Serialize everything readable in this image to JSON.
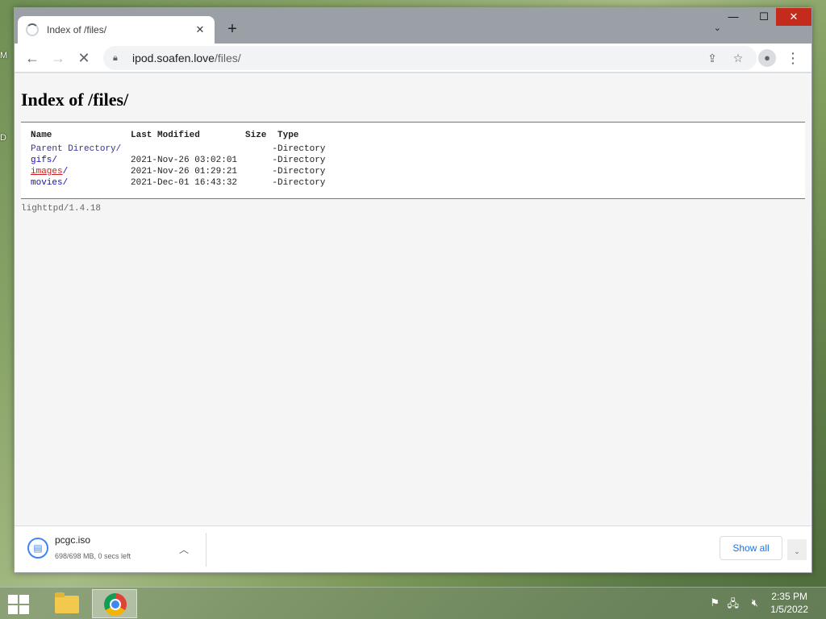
{
  "browser": {
    "tab_title": "Index of /files/",
    "new_tab_icon": "plus-icon",
    "url_host": "ipod.soafen.love",
    "url_path": "/files/"
  },
  "page": {
    "heading": "Index of /files/",
    "columns": [
      "Name",
      "Last Modified",
      "Size",
      "Type"
    ],
    "rows": [
      {
        "name": "Parent Directory/",
        "modified": "",
        "size": "-",
        "type": "Directory"
      },
      {
        "name": "gifs/",
        "modified": "2021-Nov-26 03:02:01",
        "size": "-",
        "type": "Directory"
      },
      {
        "name": "images",
        "suffix": "/",
        "modified": "2021-Nov-26 01:29:21",
        "size": "-",
        "type": "Directory"
      },
      {
        "name": "movies/",
        "modified": "2021-Dec-01 16:43:32",
        "size": "-",
        "type": "Directory"
      }
    ],
    "server_signature": "lighttpd/1.4.18"
  },
  "download": {
    "filename": "pcgc.iso",
    "status": "698/698 MB, 0 secs left",
    "show_all_label": "Show all"
  },
  "taskbar": {
    "time": "2:35 PM",
    "date": "1/5/2022"
  },
  "desktop": {
    "icon_label_1": "M",
    "icon_label_2": "D"
  },
  "colors": {
    "link": "#1a0dab",
    "visited_link": "#c5221f",
    "close_button": "#c42b1c",
    "accent": "#1a73e8"
  }
}
